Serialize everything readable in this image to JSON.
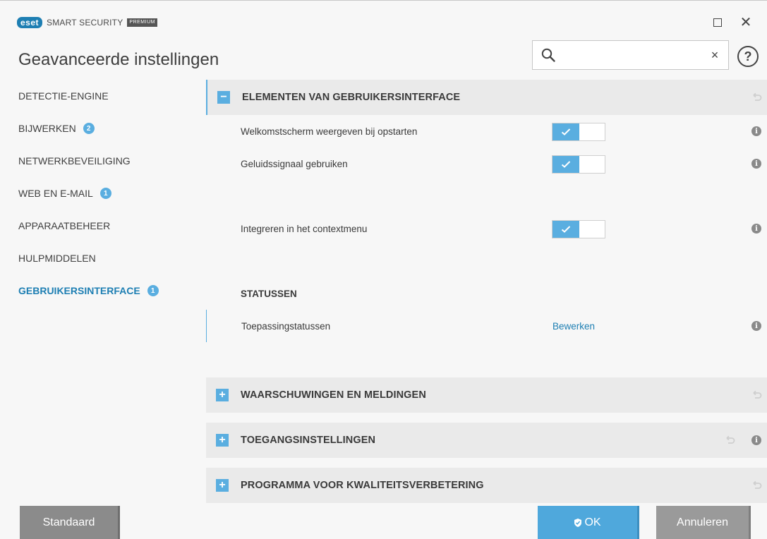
{
  "app": {
    "brand": "eset",
    "product": "SMART SECURITY",
    "tier": "PREMIUM"
  },
  "page": {
    "title": "Geavanceerde instellingen"
  },
  "search": {
    "value": "",
    "placeholder": "",
    "clear_label": "×"
  },
  "help": {
    "label": "?"
  },
  "sidebar": {
    "items": [
      {
        "label": "DETECTIE-ENGINE",
        "badge": null,
        "active": false
      },
      {
        "label": "BIJWERKEN",
        "badge": "2",
        "active": false
      },
      {
        "label": "NETWERKBEVEILIGING",
        "badge": null,
        "active": false
      },
      {
        "label": "WEB EN E-MAIL",
        "badge": "1",
        "active": false
      },
      {
        "label": "APPARAATBEHEER",
        "badge": null,
        "active": false
      },
      {
        "label": "HULPMIDDELEN",
        "badge": null,
        "active": false
      },
      {
        "label": "GEBRUIKERSINTERFACE",
        "badge": "1",
        "active": true
      }
    ]
  },
  "sections": {
    "ui_elements": {
      "title": "ELEMENTEN VAN GEBRUIKERSINTERFACE",
      "toggle": "−",
      "rows": {
        "splash": {
          "label": "Welkomstscherm weergeven bij opstarten",
          "enabled": true
        },
        "sound": {
          "label": "Geluidssignaal gebruiken",
          "enabled": true
        },
        "context": {
          "label": "Integreren in het contextmenu",
          "enabled": true
        }
      },
      "statuses": {
        "heading": "STATUSSEN",
        "row_label": "Toepassingstatussen",
        "link": "Bewerken"
      }
    },
    "warnings": {
      "title": "WAARSCHUWINGEN EN MELDINGEN",
      "toggle": "+"
    },
    "access": {
      "title": "TOEGANGSINSTELLINGEN",
      "toggle": "+"
    },
    "quality": {
      "title": "PROGRAMMA VOOR KWALITEITSVERBETERING",
      "toggle": "+"
    }
  },
  "icons": {
    "info": "i"
  },
  "footer": {
    "default_label": "Standaard",
    "ok_label": "OK",
    "cancel_label": "Annuleren"
  },
  "colors": {
    "accent": "#5aaee0",
    "brand": "#1e7fb3",
    "ok_button": "#4fa8dc",
    "neutral_button": "#8b8b8b"
  }
}
